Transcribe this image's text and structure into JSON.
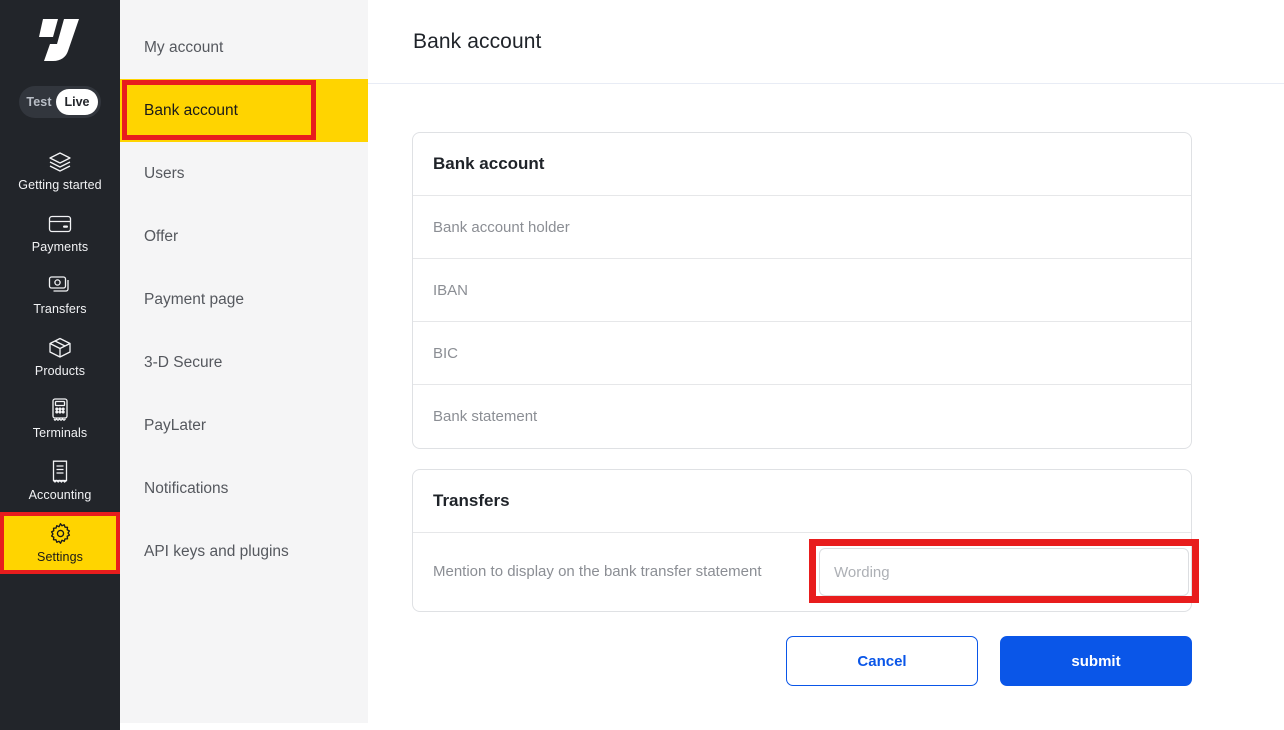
{
  "brand": {
    "logo_icon": "payplug-p-logo",
    "accent_blue": "#0A56E8",
    "highlight_yellow": "#FFD400",
    "highlight_red": "#E81D1D",
    "sidebar_bg": "#22252a"
  },
  "sidebar": {
    "env_toggle": {
      "test_label": "Test",
      "live_label": "Live",
      "selected": "Live"
    },
    "items": [
      {
        "label": "Getting started",
        "icon": "layers-icon",
        "active": false
      },
      {
        "label": "Payments",
        "icon": "credit-card-icon",
        "active": false
      },
      {
        "label": "Transfers",
        "icon": "banknotes-icon",
        "active": false
      },
      {
        "label": "Products",
        "icon": "box-icon",
        "active": false
      },
      {
        "label": "Terminals",
        "icon": "card-terminal-icon",
        "active": false
      },
      {
        "label": "Accounting",
        "icon": "receipt-icon",
        "active": false
      },
      {
        "label": "Settings",
        "icon": "gear-icon",
        "active": true
      }
    ]
  },
  "secondary_nav": {
    "items": [
      {
        "label": "My account",
        "active": false
      },
      {
        "label": "Bank account",
        "active": true
      },
      {
        "label": "Users",
        "active": false
      },
      {
        "label": "Offer",
        "active": false
      },
      {
        "label": "Payment page",
        "active": false
      },
      {
        "label": "3-D Secure",
        "active": false
      },
      {
        "label": "PayLater",
        "active": false
      },
      {
        "label": "Notifications",
        "active": false
      },
      {
        "label": "API keys and plugins",
        "active": false
      }
    ]
  },
  "header": {
    "title": "Bank account"
  },
  "main": {
    "bank_account_card": {
      "title": "Bank account",
      "rows": [
        {
          "label": "Bank account holder"
        },
        {
          "label": "IBAN"
        },
        {
          "label": "BIC"
        },
        {
          "label": "Bank statement"
        }
      ]
    },
    "transfers_card": {
      "title": "Transfers",
      "mention_label": "Mention to display on the bank transfer statement",
      "wording_value": "",
      "wording_placeholder": "Wording"
    },
    "actions": {
      "cancel_label": "Cancel",
      "submit_label": "submit"
    }
  }
}
